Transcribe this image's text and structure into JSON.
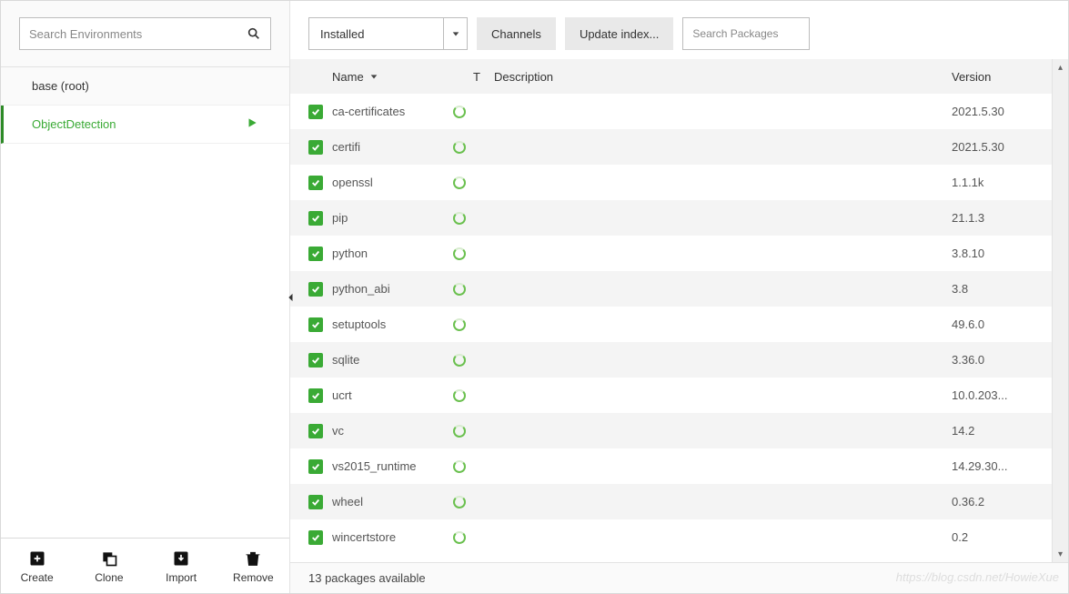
{
  "sidebar": {
    "search_placeholder": "Search Environments",
    "environments": [
      {
        "name": "base (root)",
        "selected": false
      },
      {
        "name": "ObjectDetection",
        "selected": true
      }
    ],
    "actions": {
      "create": "Create",
      "clone": "Clone",
      "import": "Import",
      "remove": "Remove"
    }
  },
  "toolbar": {
    "filter_value": "Installed",
    "channels_label": "Channels",
    "update_index_label": "Update index...",
    "pkg_search_placeholder": "Search Packages"
  },
  "table": {
    "headers": {
      "name": "Name",
      "t": "T",
      "description": "Description",
      "version": "Version"
    },
    "rows": [
      {
        "name": "ca-certificates",
        "version": "2021.5.30"
      },
      {
        "name": "certifi",
        "version": "2021.5.30"
      },
      {
        "name": "openssl",
        "version": "1.1.1k"
      },
      {
        "name": "pip",
        "version": "21.1.3"
      },
      {
        "name": "python",
        "version": "3.8.10"
      },
      {
        "name": "python_abi",
        "version": "3.8"
      },
      {
        "name": "setuptools",
        "version": "49.6.0"
      },
      {
        "name": "sqlite",
        "version": "3.36.0"
      },
      {
        "name": "ucrt",
        "version": "10.0.203..."
      },
      {
        "name": "vc",
        "version": "14.2"
      },
      {
        "name": "vs2015_runtime",
        "version": "14.29.30..."
      },
      {
        "name": "wheel",
        "version": "0.36.2"
      },
      {
        "name": "wincertstore",
        "version": "0.2"
      }
    ]
  },
  "status": {
    "text": "13 packages available"
  },
  "watermark": "https://blog.csdn.net/HowieXue"
}
